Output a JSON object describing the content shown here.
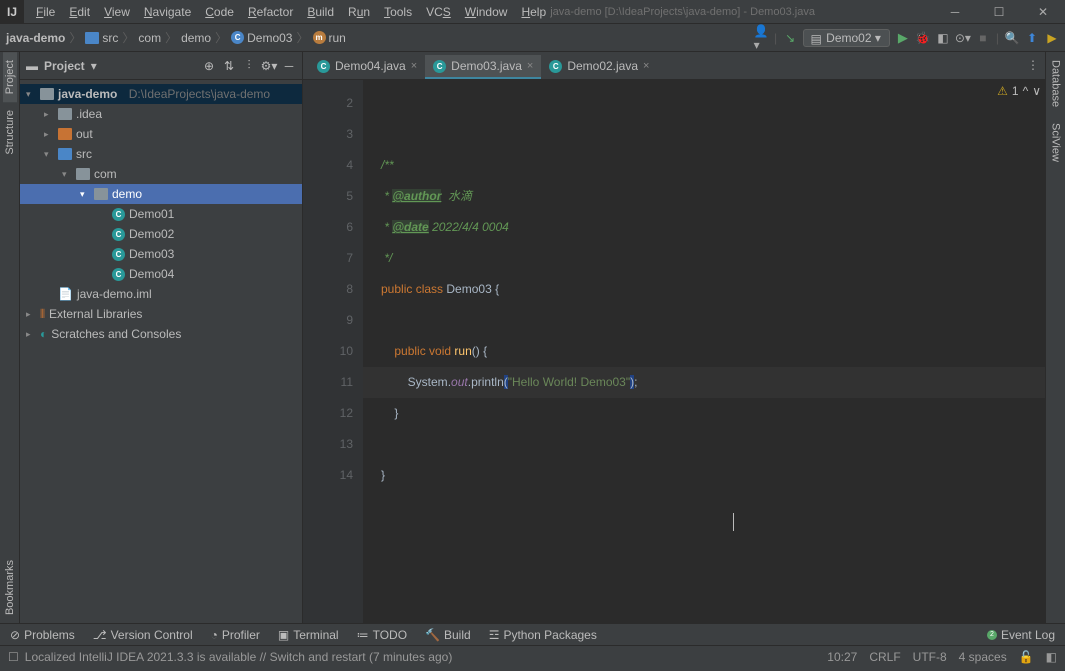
{
  "window": {
    "title": "java-demo [D:\\IdeaProjects\\java-demo] - Demo03.java"
  },
  "menu": [
    "File",
    "Edit",
    "View",
    "Navigate",
    "Code",
    "Refactor",
    "Build",
    "Run",
    "Tools",
    "VCS",
    "Window",
    "Help"
  ],
  "breadcrumbs": [
    "java-demo",
    "src",
    "com",
    "demo",
    "Demo03",
    "run"
  ],
  "run_config": "Demo02",
  "sidebar": {
    "title": "Project",
    "tree": {
      "project": "java-demo",
      "project_path": "D:\\IdeaProjects\\java-demo",
      "idea": ".idea",
      "out": "out",
      "src": "src",
      "com": "com",
      "demo": "demo",
      "d1": "Demo01",
      "d2": "Demo02",
      "d3": "Demo03",
      "d4": "Demo04",
      "iml": "java-demo.iml",
      "libs": "External Libraries",
      "scratch": "Scratches and Consoles"
    }
  },
  "left_tabs": {
    "project": "Project",
    "structure": "Structure",
    "bookmarks": "Bookmarks"
  },
  "right_tabs": {
    "database": "Database",
    "sciview": "SciView"
  },
  "editor": {
    "tabs": [
      {
        "name": "Demo04.java",
        "active": false
      },
      {
        "name": "Demo03.java",
        "active": true
      },
      {
        "name": "Demo02.java",
        "active": false
      }
    ],
    "warnings": "1",
    "lines": {
      "author": "@author",
      "author_v": "水滴",
      "date": "@date",
      "date_v": "2022/4/4 0004",
      "pub": "public",
      "cls": "class",
      "clsname": "Demo03",
      "brace": "{",
      "void": "void",
      "run": "run",
      "paren": "()",
      "brace2": "{",
      "sys": "System",
      "dot": ".",
      "out": "out",
      "println": "println",
      "str": "\"Hello World! Demo03\"",
      "semi": ";",
      "close": "}"
    }
  },
  "bottom_tools": {
    "problems": "Problems",
    "vcs": "Version Control",
    "profiler": "Profiler",
    "terminal": "Terminal",
    "todo": "TODO",
    "build": "Build",
    "py": "Python Packages",
    "event": "Event Log",
    "event_n": "2"
  },
  "status": {
    "msg": "Localized IntelliJ IDEA 2021.3.3 is available // Switch and restart (7 minutes ago)",
    "pos": "10:27",
    "crlf": "CRLF",
    "enc": "UTF-8",
    "indent": "4 spaces"
  }
}
